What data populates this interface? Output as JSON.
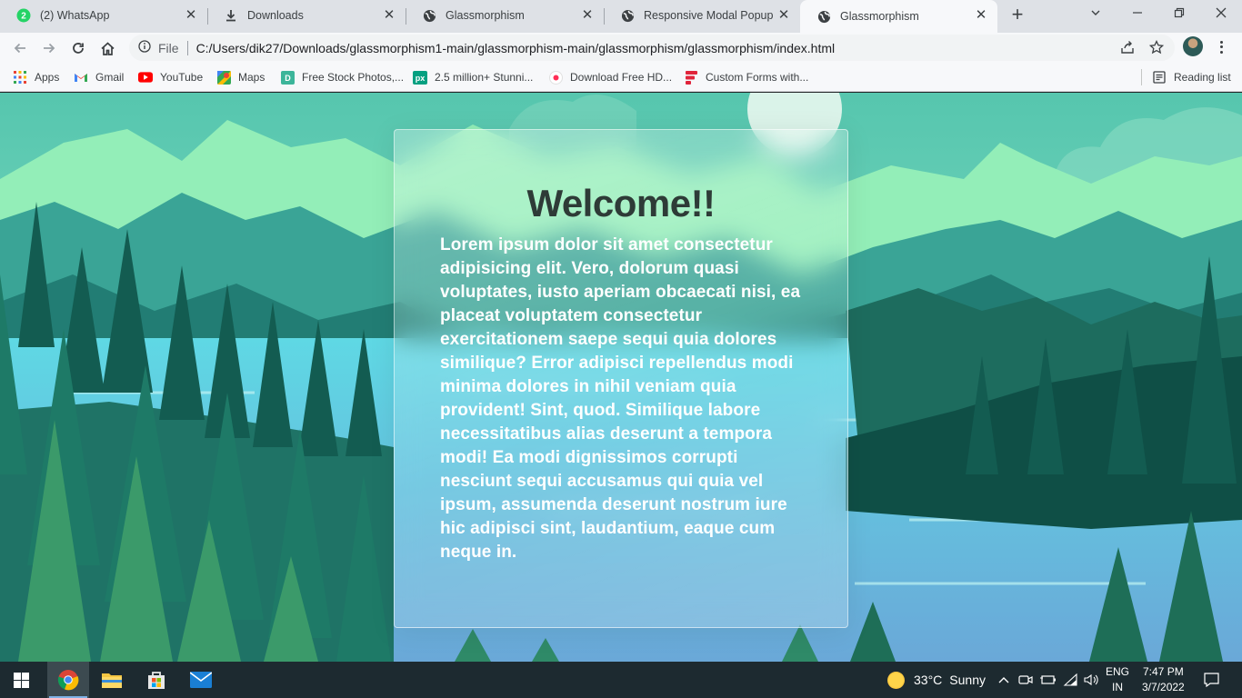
{
  "browser": {
    "tabs": [
      {
        "title": "(2) WhatsApp",
        "icon": "whatsapp-icon",
        "active": false
      },
      {
        "title": "Downloads",
        "icon": "download-icon",
        "active": false
      },
      {
        "title": "Glassmorphism",
        "icon": "globe-icon",
        "active": false
      },
      {
        "title": "Responsive Modal Popup",
        "icon": "globe-icon",
        "active": false
      },
      {
        "title": "Glassmorphism",
        "icon": "globe-icon",
        "active": true
      }
    ],
    "address": {
      "scheme_label": "File",
      "url": "C:/Users/dik27/Downloads/glassmorphism1-main/glassmorphism-main/glassmorphism/glassmorphism/index.html"
    },
    "bookmarks": [
      {
        "label": "Apps",
        "icon": "apps-grid-icon"
      },
      {
        "label": "Gmail",
        "icon": "gmail-icon"
      },
      {
        "label": "YouTube",
        "icon": "youtube-icon"
      },
      {
        "label": "Maps",
        "icon": "maps-icon"
      },
      {
        "label": "Free Stock Photos,...",
        "icon": "stock-photos-icon"
      },
      {
        "label": "2.5 million+ Stunni...",
        "icon": "pexels-icon"
      },
      {
        "label": "Download Free HD...",
        "icon": "record-icon"
      },
      {
        "label": "Custom Forms with...",
        "icon": "forms-icon"
      }
    ],
    "reading_list_label": "Reading list"
  },
  "page": {
    "heading": "Welcome!!",
    "body": "Lorem ipsum dolor sit amet consectetur adipisicing elit. Vero, dolorum quasi voluptates, iusto aperiam obcaecati nisi, ea placeat voluptatem consectetur exercitationem saepe sequi quia dolores similique? Error adipisci repellendus modi minima dolores in nihil veniam quia provident! Sint, quod. Similique labore necessitatibus alias deserunt a tempora modi! Ea modi dignissimos corrupti nesciunt sequi accusamus qui quia vel ipsum, assumenda deserunt nostrum iure hic adipisci sint, laudantium, eaque cum neque in."
  },
  "taskbar": {
    "weather": {
      "temp": "33°C",
      "condition": "Sunny"
    },
    "language": {
      "lang": "ENG",
      "region": "IN"
    },
    "clock": {
      "time": "7:47 PM",
      "date": "3/7/2022"
    }
  },
  "colors": {
    "card_heading": "#2e3b37",
    "card_text": "#ffffff",
    "taskbar": "#1d2a30",
    "tab_strip": "#dee1e6"
  }
}
